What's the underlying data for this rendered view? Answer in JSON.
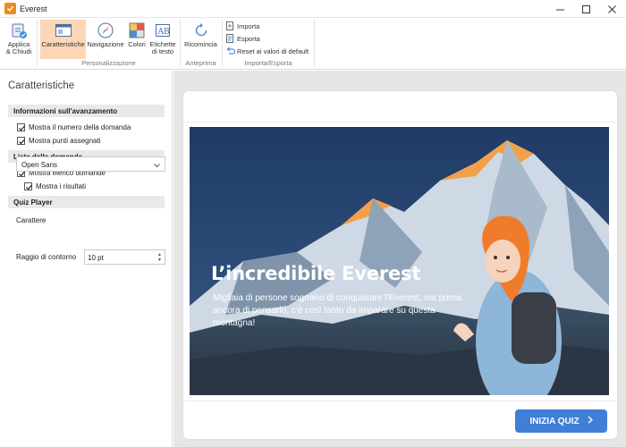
{
  "window": {
    "title": "Everest"
  },
  "ribbon": {
    "buttons": {
      "apply_close": "Applica\n& Chiudi",
      "features": "Caratteristiche",
      "navigation": "Navigazione",
      "colors": "Colori",
      "text_labels": "Etichette\ndi testo",
      "restart": "Ricomincia"
    },
    "small": {
      "import": "Importa",
      "export": "Esporta",
      "reset": "Reset ai valori di default"
    },
    "groups": {
      "customization": "Personalizzazione",
      "preview": "Anteprima",
      "import_export": "Importa/Esporta"
    }
  },
  "panel": {
    "title": "Caratteristiche",
    "sections": {
      "progress": "Informazioni sull'avanzamento",
      "question_list": "Lista delle domande",
      "quiz_player": "Quiz Player"
    },
    "checkboxes": {
      "show_question_number": {
        "label": "Mostra il numero della domanda",
        "checked": true
      },
      "show_points": {
        "label": "Mostra punti assegnati",
        "checked": true
      },
      "show_question_list": {
        "label": "Mostra elenco domande",
        "checked": true
      },
      "show_results": {
        "label": "Mostra i risultati",
        "checked": true
      }
    },
    "font": {
      "label": "Carattere",
      "value": "Open Sans"
    },
    "border_radius": {
      "label": "Raggio di contorno",
      "value": "10 pt"
    }
  },
  "preview": {
    "title": "L’incredibile Everest",
    "text": "Migliaia di persone sognano di conquistare l'Everest, ma prima ancora di pensarlo, c'è così tanto da imparare su questa montagna!",
    "start_button": "INIZIA QUIZ"
  },
  "colors": {
    "accent_orange": "#f08a1c",
    "active_tab": "#fcd6b5",
    "primary_button": "#3f7fd7"
  }
}
